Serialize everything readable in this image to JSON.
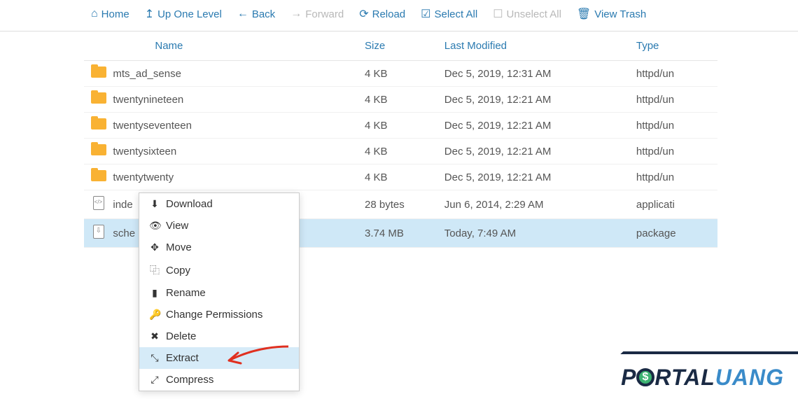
{
  "toolbar": {
    "home": "Home",
    "up": "Up One Level",
    "back": "Back",
    "forward": "Forward",
    "reload": "Reload",
    "select_all": "Select All",
    "unselect_all": "Unselect All",
    "view_trash": "View Trash"
  },
  "columns": {
    "name": "Name",
    "size": "Size",
    "modified": "Last Modified",
    "type": "Type"
  },
  "rows": [
    {
      "icon": "folder",
      "name": "mts_ad_sense",
      "size": "4 KB",
      "modified": "Dec 5, 2019, 12:31 AM",
      "type": "httpd/un"
    },
    {
      "icon": "folder",
      "name": "twentynineteen",
      "size": "4 KB",
      "modified": "Dec 5, 2019, 12:21 AM",
      "type": "httpd/un"
    },
    {
      "icon": "folder",
      "name": "twentyseventeen",
      "size": "4 KB",
      "modified": "Dec 5, 2019, 12:21 AM",
      "type": "httpd/un"
    },
    {
      "icon": "folder",
      "name": "twentysixteen",
      "size": "4 KB",
      "modified": "Dec 5, 2019, 12:21 AM",
      "type": "httpd/un"
    },
    {
      "icon": "folder",
      "name": "twentytwenty",
      "size": "4 KB",
      "modified": "Dec 5, 2019, 12:21 AM",
      "type": "httpd/un"
    },
    {
      "icon": "file-code",
      "name": "inde",
      "size": "28 bytes",
      "modified": "Jun 6, 2014, 2:29 AM",
      "type": "applicati"
    },
    {
      "icon": "file-zip",
      "name": "sche",
      "size": "3.74 MB",
      "modified": "Today, 7:49 AM",
      "type": "package",
      "selected": true
    }
  ],
  "context_menu": {
    "download": "Download",
    "view": "View",
    "move": "Move",
    "copy": "Copy",
    "rename": "Rename",
    "permissions": "Change Permissions",
    "delete": "Delete",
    "extract": "Extract",
    "compress": "Compress"
  },
  "watermark": {
    "part1": "P",
    "part2": "RTAL",
    "part3": "UANG",
    "coin": "$"
  }
}
